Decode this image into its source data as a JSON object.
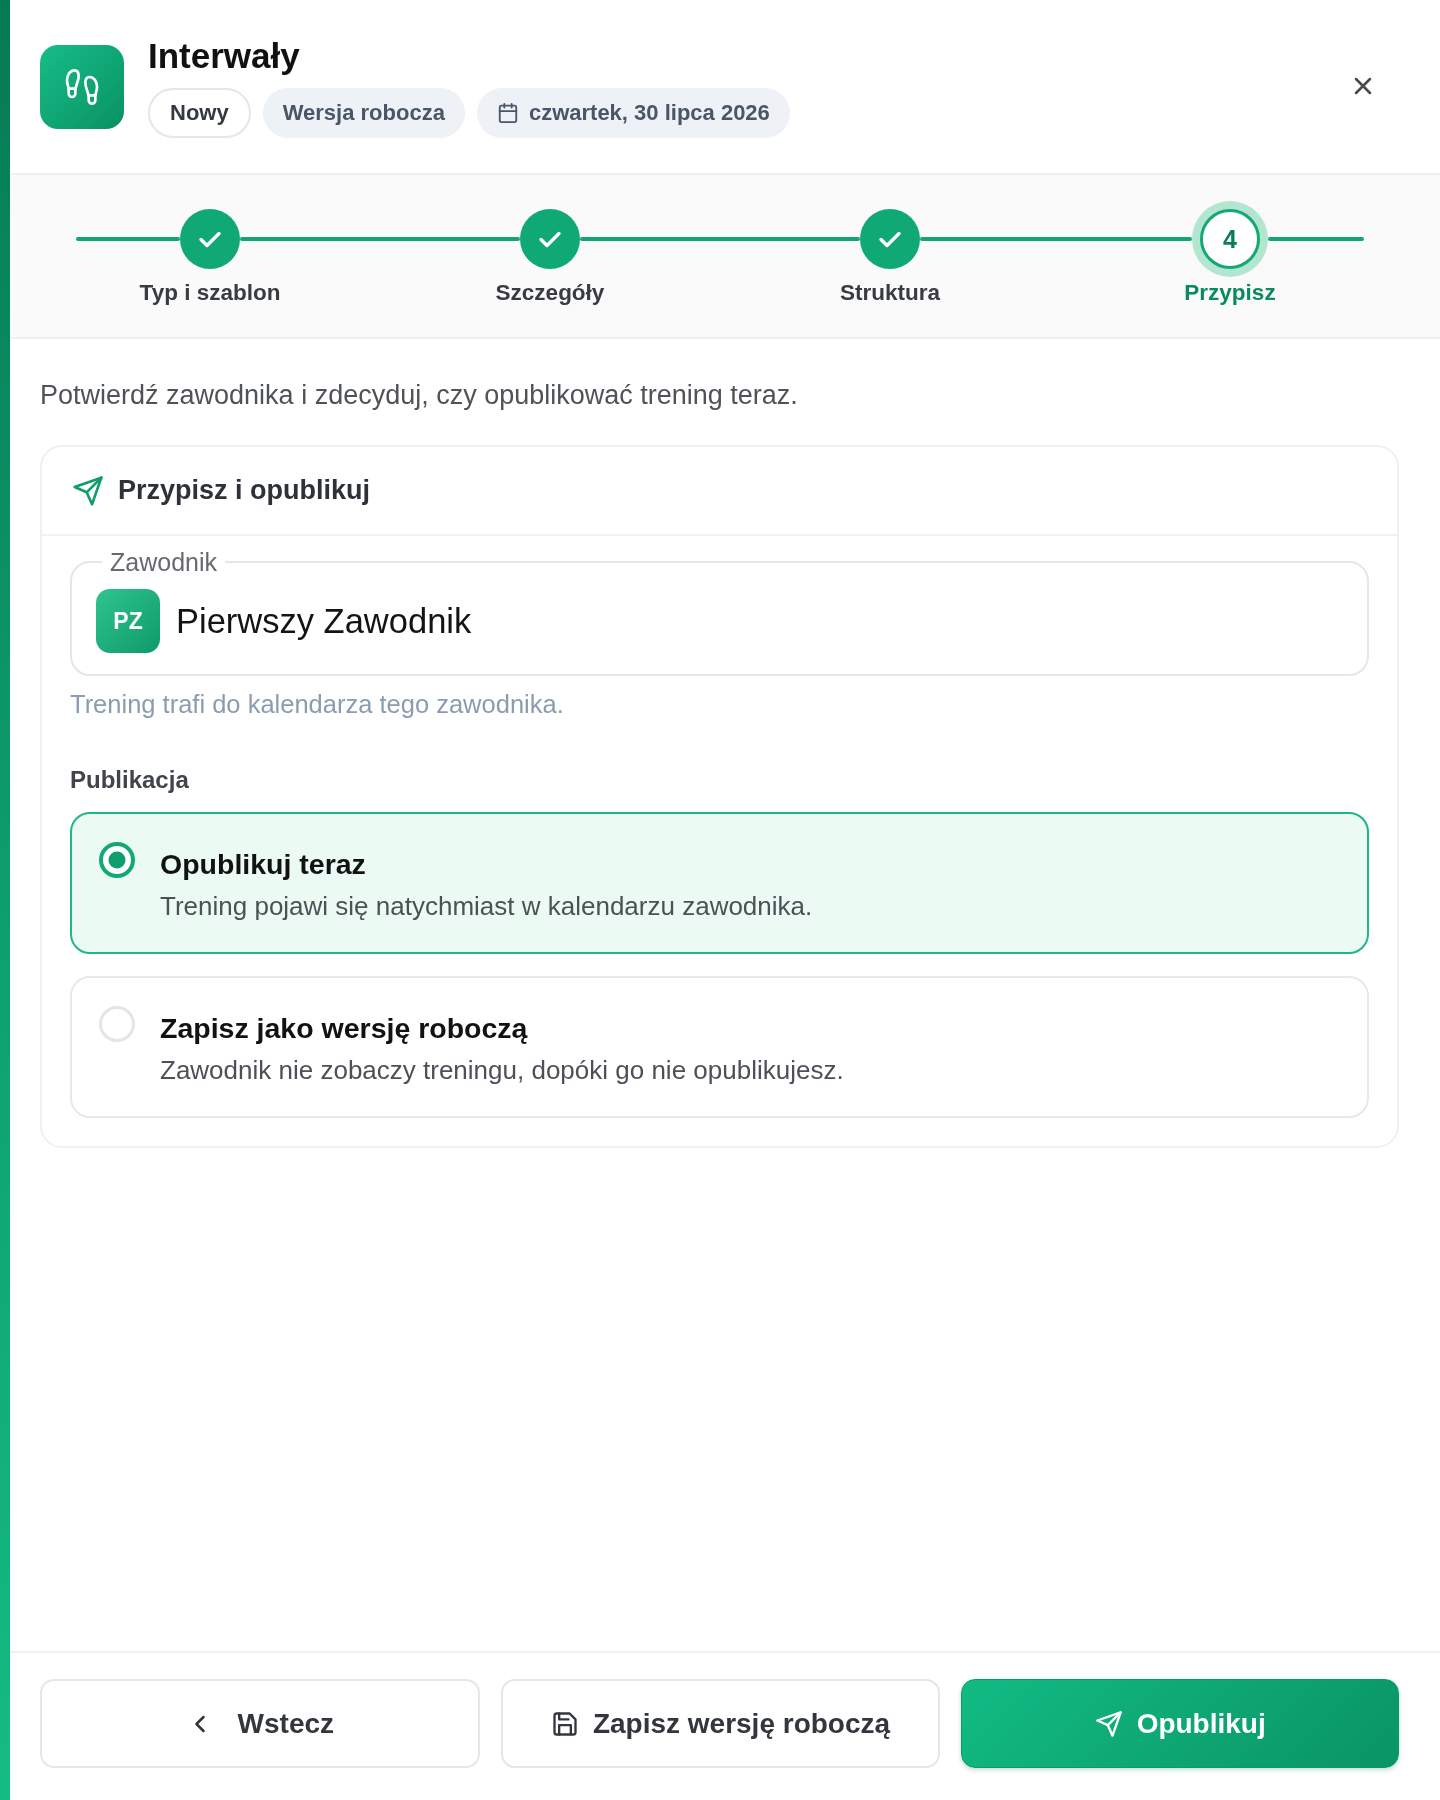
{
  "header": {
    "title": "Interwały",
    "tags": [
      {
        "kind": "outline",
        "label": "Nowy"
      },
      {
        "kind": "filled",
        "label": "Wersja robocza"
      },
      {
        "kind": "date",
        "label": "czwartek, 30 lipca 2026"
      }
    ]
  },
  "stepper": {
    "steps": [
      {
        "label": "Typ i szablon",
        "completed": true,
        "selected": false
      },
      {
        "label": "Szczegóły",
        "completed": true,
        "selected": false
      },
      {
        "label": "Struktura",
        "completed": true,
        "selected": false
      },
      {
        "label": "Przypisz",
        "number": "4",
        "completed": false,
        "selected": true
      }
    ]
  },
  "intro": "Potwierdź zawodnika i zdecyduj, czy opublikować trening teraz.",
  "card": {
    "title": "Przypisz i opublikuj",
    "athlete_field": {
      "label": "Zawodnik",
      "initials": "PZ",
      "value": "Pierwszy Zawodnik",
      "helper": "Trening trafi do kalendarza tego zawodnika."
    },
    "publication": {
      "label": "Publikacja",
      "options": [
        {
          "title": "Opublikuj teraz",
          "description": "Trening pojawi się natychmiast w kalendarzu zawodnika.",
          "selected": true
        },
        {
          "title": "Zapisz jako wersję roboczą",
          "description": "Zawodnik nie zobaczy treningu, dopóki go nie opublikujesz.",
          "selected": false
        }
      ]
    }
  },
  "footer": {
    "buttons": [
      {
        "kind": "back",
        "label": "Wstecz"
      },
      {
        "kind": "save",
        "label": "Zapisz wersję roboczą"
      },
      {
        "kind": "primary",
        "label": "Opublikuj"
      }
    ]
  }
}
